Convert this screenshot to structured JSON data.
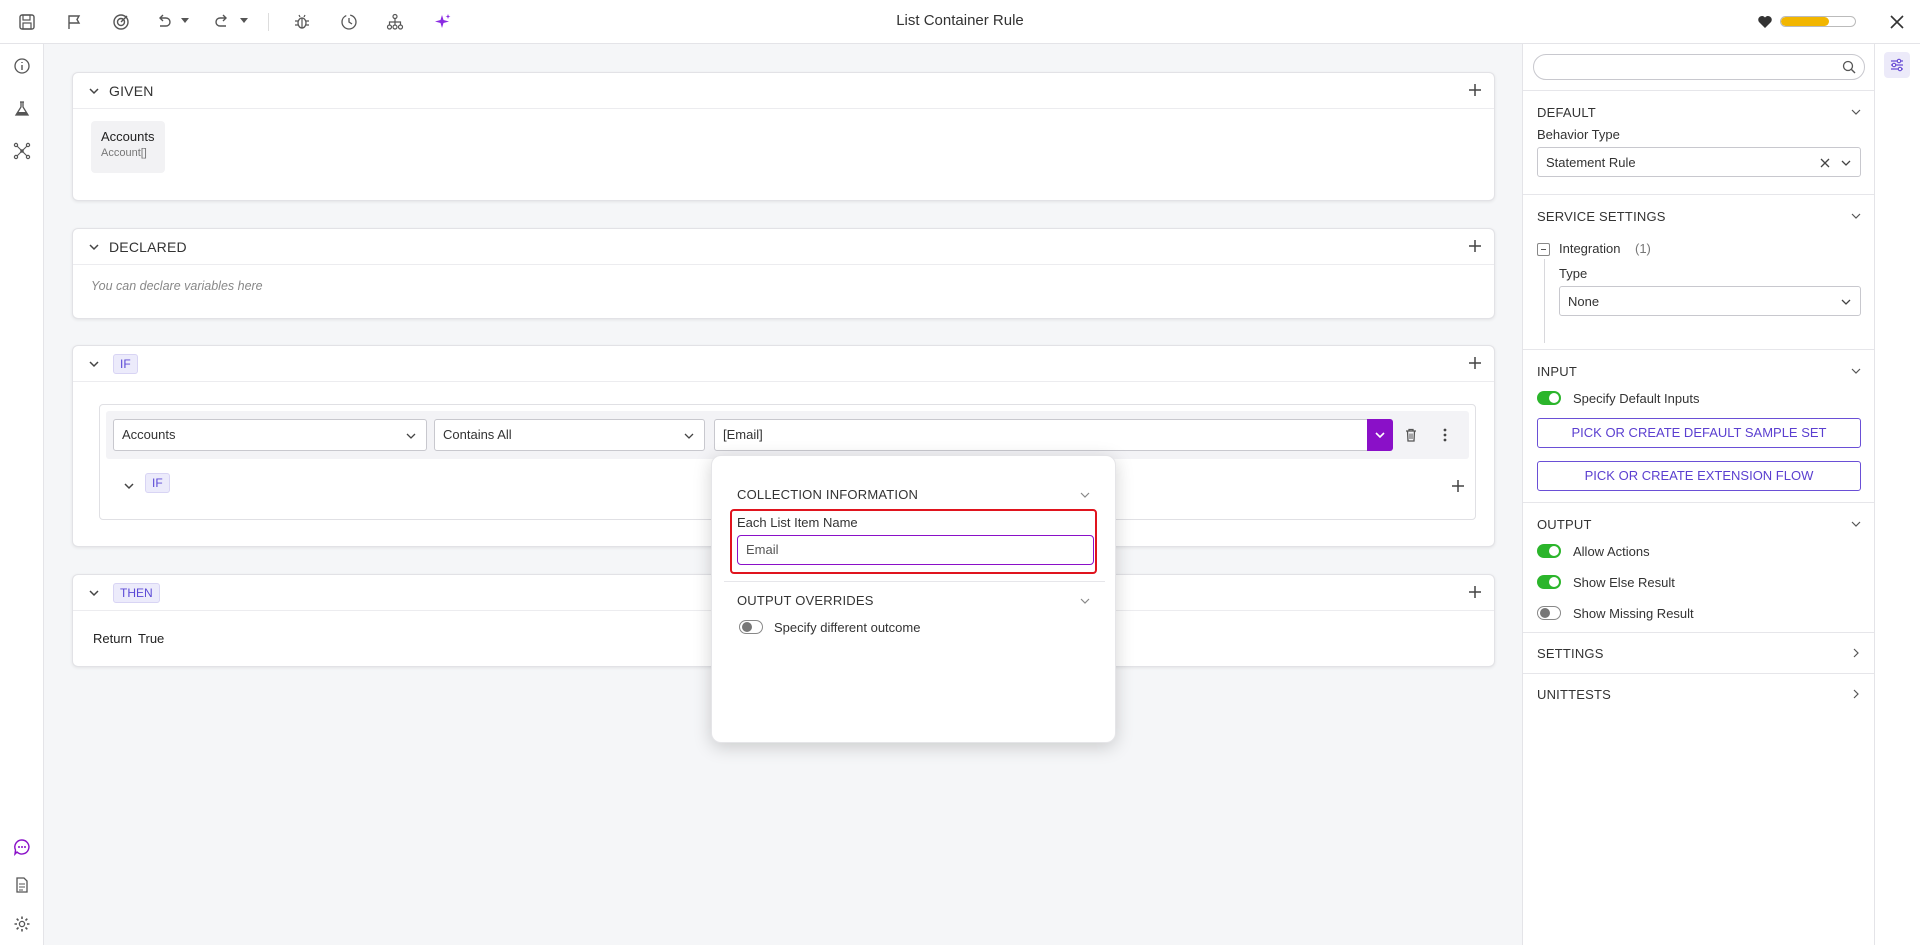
{
  "window": {
    "title": "List Container Rule"
  },
  "health": {
    "level_percent": 65,
    "color": "#f2b600"
  },
  "colors": {
    "accent_purple": "#8a10c8",
    "toggle_on": "#2bb52b",
    "highlight_red": "#e0141e"
  },
  "toolbar": {
    "icons": [
      "save-icon",
      "flag-icon",
      "target-icon",
      "undo-icon",
      "redo-icon",
      "bug-icon",
      "history-icon",
      "hierarchy-icon",
      "sparkle-icon",
      "heart-icon",
      "close-icon"
    ]
  },
  "left_rail": {
    "icons": [
      "info-icon",
      "flask-icon",
      "network-icon",
      "chat-icon",
      "document-icon",
      "settings-gear-icon"
    ]
  },
  "given": {
    "title": "GIVEN",
    "chips": [
      {
        "name": "Accounts",
        "type": "Account[]"
      }
    ]
  },
  "declared": {
    "title": "DECLARED",
    "placeholder": "You can declare variables here"
  },
  "if_section": {
    "tag": "IF",
    "condition": {
      "left": "Accounts",
      "operator": "Contains All",
      "right": "[Email]"
    },
    "nested_tag": "IF"
  },
  "then_section": {
    "tag": "THEN",
    "keyword": "Return",
    "value": "True"
  },
  "popup": {
    "collection_title": "COLLECTION INFORMATION",
    "item_label": "Each List Item Name",
    "item_value": "Email",
    "overrides_title": "OUTPUT OVERRIDES",
    "override_toggle_label": "Specify different outcome",
    "override_toggle_on": false
  },
  "right_panel": {
    "search_placeholder": "",
    "default": {
      "title": "DEFAULT",
      "behavior_label": "Behavior Type",
      "behavior_value": "Statement Rule"
    },
    "service": {
      "title": "SERVICE SETTINGS",
      "integration_label": "Integration",
      "integration_count": "(1)",
      "type_label": "Type",
      "type_value": "None"
    },
    "input": {
      "title": "INPUT",
      "toggle_label": "Specify Default Inputs",
      "toggle_on": true,
      "btn_sample": "PICK OR CREATE DEFAULT SAMPLE SET",
      "btn_flow": "PICK OR CREATE EXTENSION FLOW"
    },
    "output": {
      "title": "OUTPUT",
      "toggles": [
        {
          "label": "Allow Actions",
          "on": true
        },
        {
          "label": "Show Else Result",
          "on": true
        },
        {
          "label": "Show Missing Result",
          "on": false
        }
      ]
    },
    "settings": {
      "title": "SETTINGS"
    },
    "unittests": {
      "title": "UNITTESTS"
    }
  }
}
